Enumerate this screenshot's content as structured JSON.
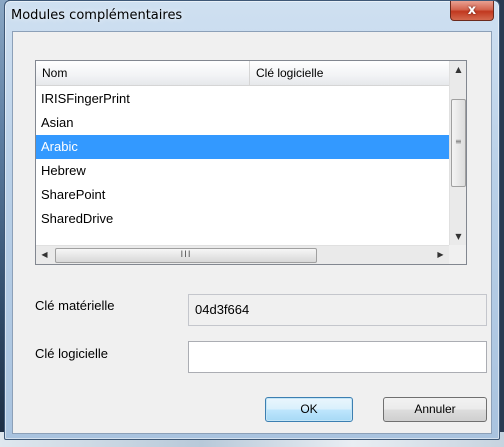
{
  "window": {
    "title": "Modules complémentaires",
    "close_glyph": "x"
  },
  "list": {
    "columns": [
      "Nom",
      "Clé logicielle"
    ],
    "rows": [
      {
        "name": "IRISFingerPrint",
        "key": ""
      },
      {
        "name": "Asian",
        "key": ""
      },
      {
        "name": "Arabic",
        "key": "",
        "selected": true
      },
      {
        "name": "Hebrew",
        "key": ""
      },
      {
        "name": "SharePoint",
        "key": ""
      },
      {
        "name": "SharedDrive",
        "key": ""
      }
    ],
    "scroll_up_icon": "▲",
    "scroll_down_icon": "▼",
    "scroll_left_icon": "◀",
    "scroll_right_icon": "▶",
    "hthumb_grip": "III"
  },
  "hardware_key": {
    "label": "Clé matérielle",
    "value": "04d3f664"
  },
  "software_key": {
    "label": "Clé logicielle",
    "value": ""
  },
  "buttons": {
    "ok": "OK",
    "cancel": "Annuler"
  }
}
